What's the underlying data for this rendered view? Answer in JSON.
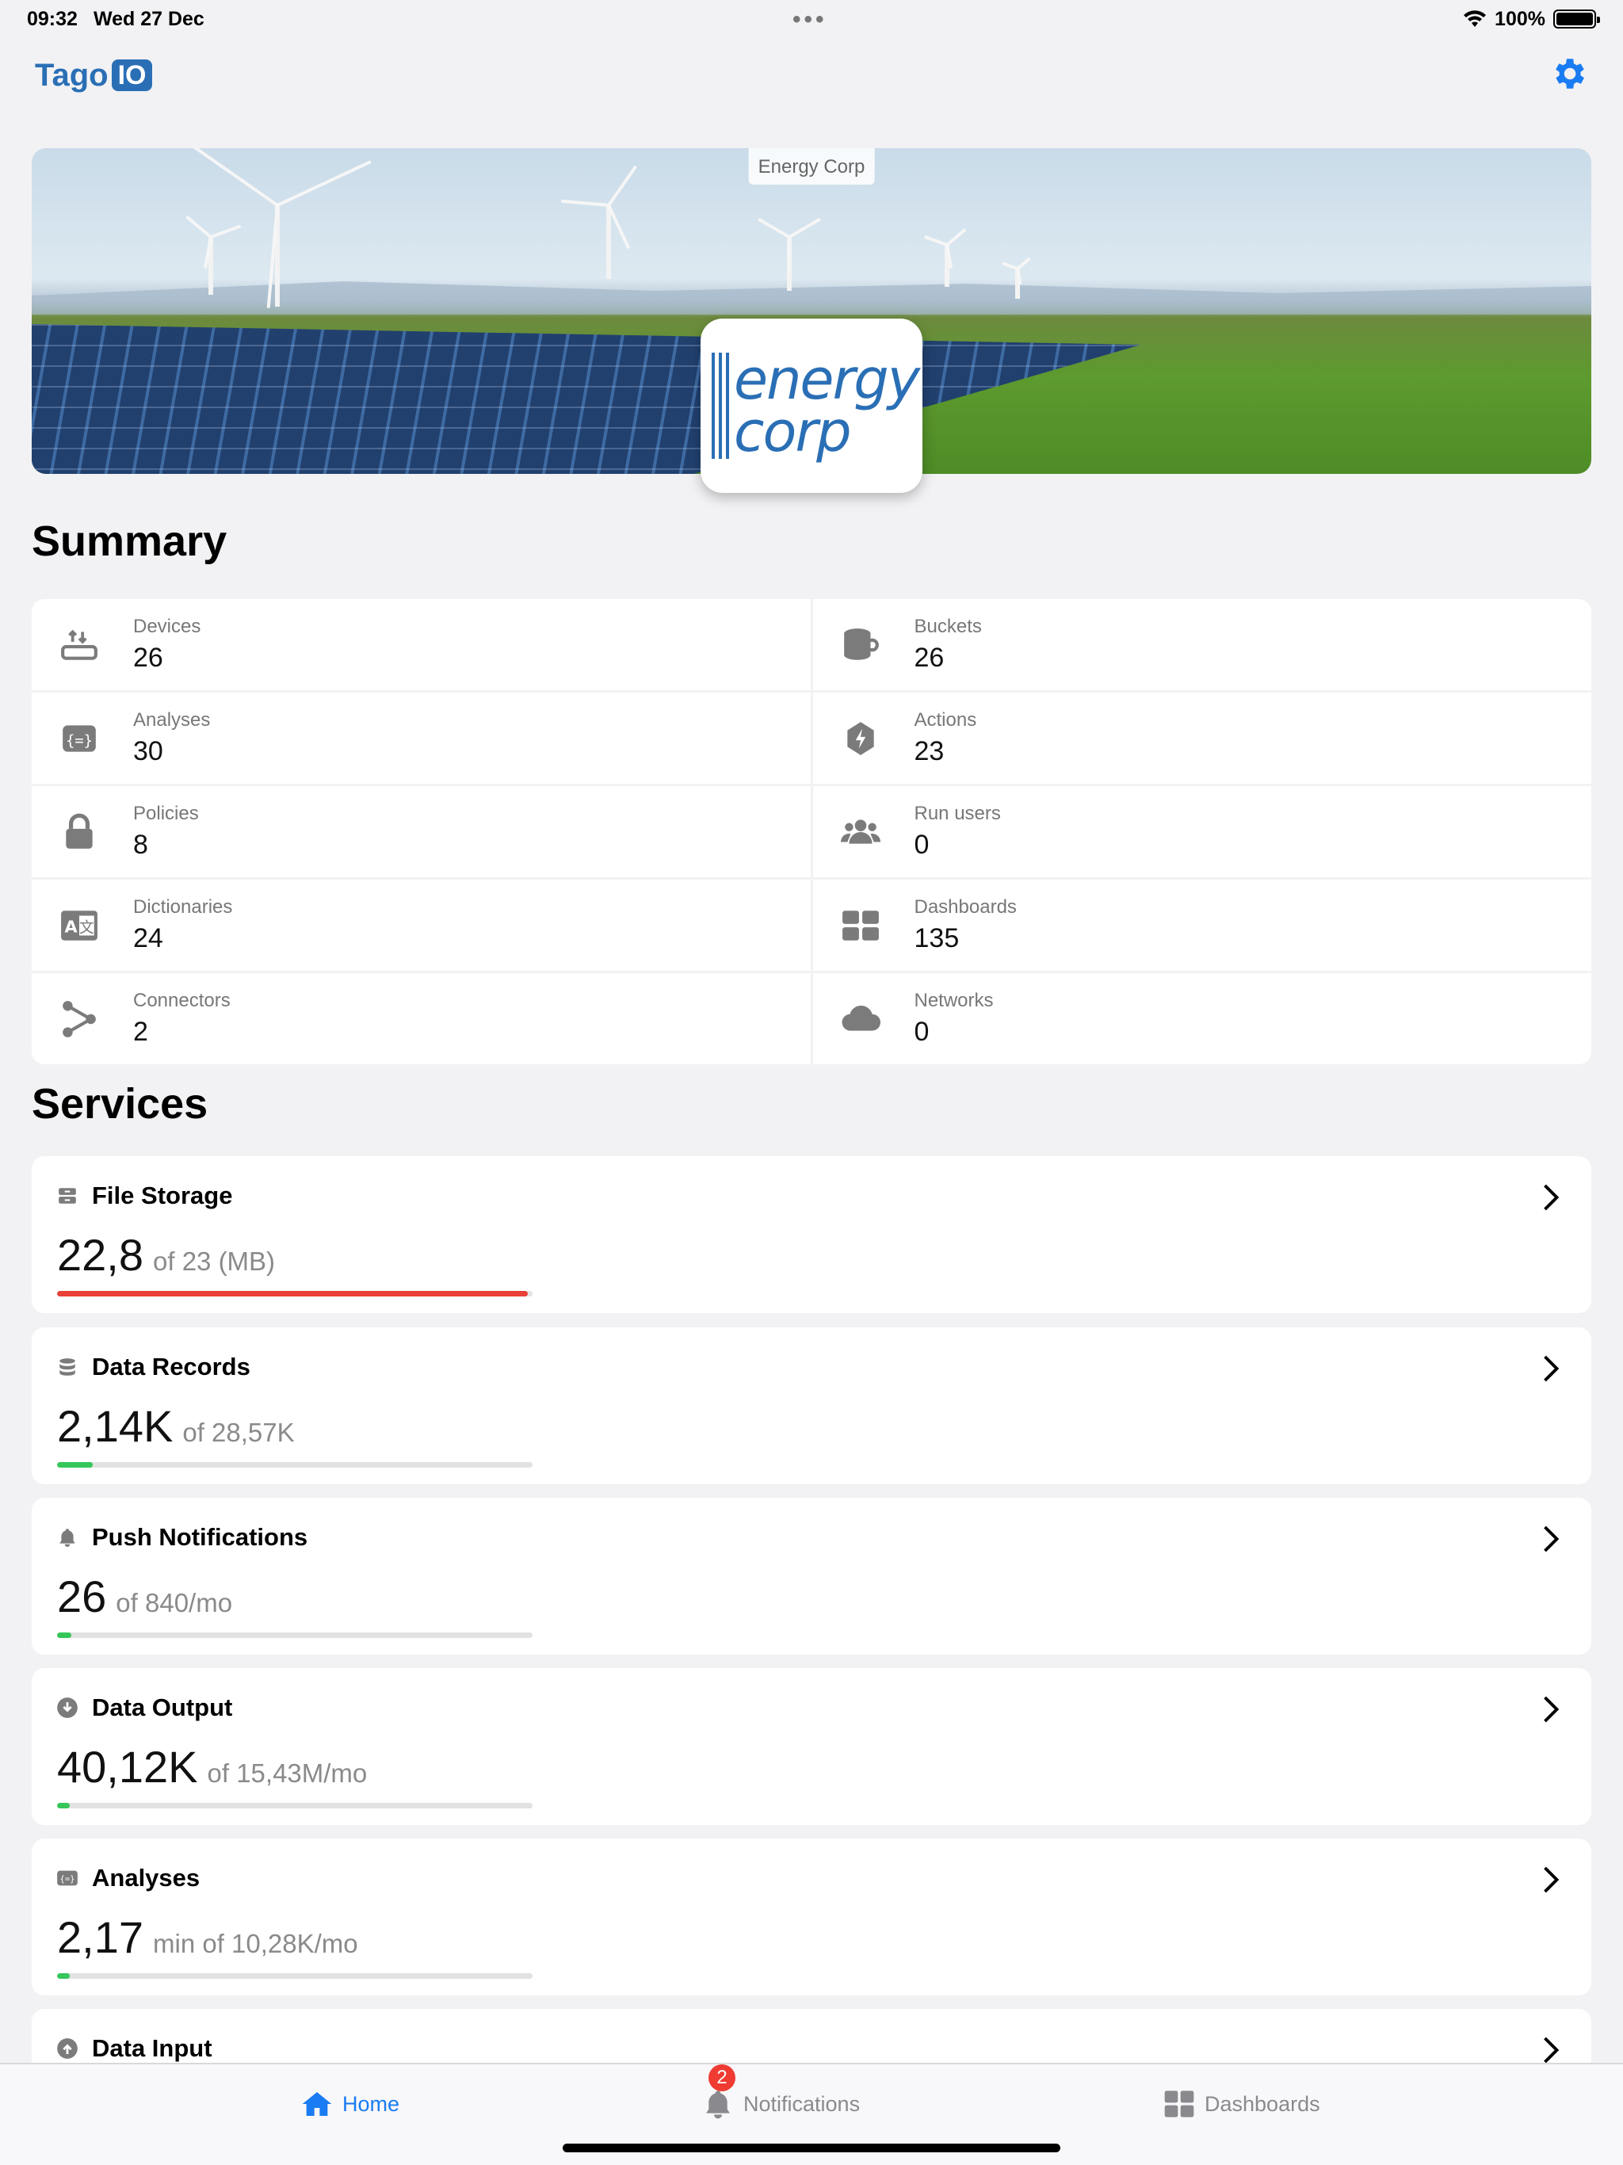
{
  "status_bar": {
    "time": "09:32",
    "date": "Wed 27 Dec",
    "battery": "100%"
  },
  "header": {
    "logo_text": "Tago",
    "logo_badge": "IO"
  },
  "banner": {
    "org_name": "Energy Corp",
    "brand_line1": "energy",
    "brand_line2": "corp"
  },
  "summary": {
    "title": "Summary",
    "items": [
      {
        "label": "Devices",
        "value": "26",
        "icon": "device-icon"
      },
      {
        "label": "Buckets",
        "value": "26",
        "icon": "bucket-icon"
      },
      {
        "label": "Analyses",
        "value": "30",
        "icon": "code-icon"
      },
      {
        "label": "Actions",
        "value": "23",
        "icon": "bolt-icon"
      },
      {
        "label": "Policies",
        "value": "8",
        "icon": "lock-icon"
      },
      {
        "label": "Run users",
        "value": "0",
        "icon": "users-icon"
      },
      {
        "label": "Dictionaries",
        "value": "24",
        "icon": "translate-icon"
      },
      {
        "label": "Dashboards",
        "value": "135",
        "icon": "grid-icon"
      },
      {
        "label": "Connectors",
        "value": "2",
        "icon": "connector-icon"
      },
      {
        "label": "Networks",
        "value": "0",
        "icon": "cloud-icon"
      }
    ]
  },
  "services": {
    "title": "Services",
    "items": [
      {
        "name": "File Storage",
        "value": "22,8",
        "limit": "of 23 (MB)",
        "usage_fraction": 0.99,
        "bar_color": "#e94037",
        "icon": "storage-icon"
      },
      {
        "name": "Data Records",
        "value": "2,14K",
        "limit": "of 28,57K",
        "usage_fraction": 0.075,
        "bar_color": "#34c759",
        "icon": "database-icon"
      },
      {
        "name": "Push Notifications",
        "value": "26",
        "limit": "of 840/mo",
        "usage_fraction": 0.03,
        "bar_color": "#34c759",
        "icon": "bell-icon"
      },
      {
        "name": "Data Output",
        "value": "40,12K",
        "limit": "of 15,43M/mo",
        "usage_fraction": 0.026,
        "bar_color": "#34c759",
        "icon": "download-icon"
      },
      {
        "name": "Analyses",
        "value": "2,17",
        "limit": "min of 10,28K/mo",
        "usage_fraction": 0.026,
        "bar_color": "#34c759",
        "icon": "code-icon"
      },
      {
        "name": "Data Input",
        "icon": "upload-icon"
      }
    ]
  },
  "tabbar": {
    "home": "Home",
    "notifications": "Notifications",
    "notifications_badge": "2",
    "dashboards": "Dashboards",
    "active_color": "#1a7cf2"
  }
}
